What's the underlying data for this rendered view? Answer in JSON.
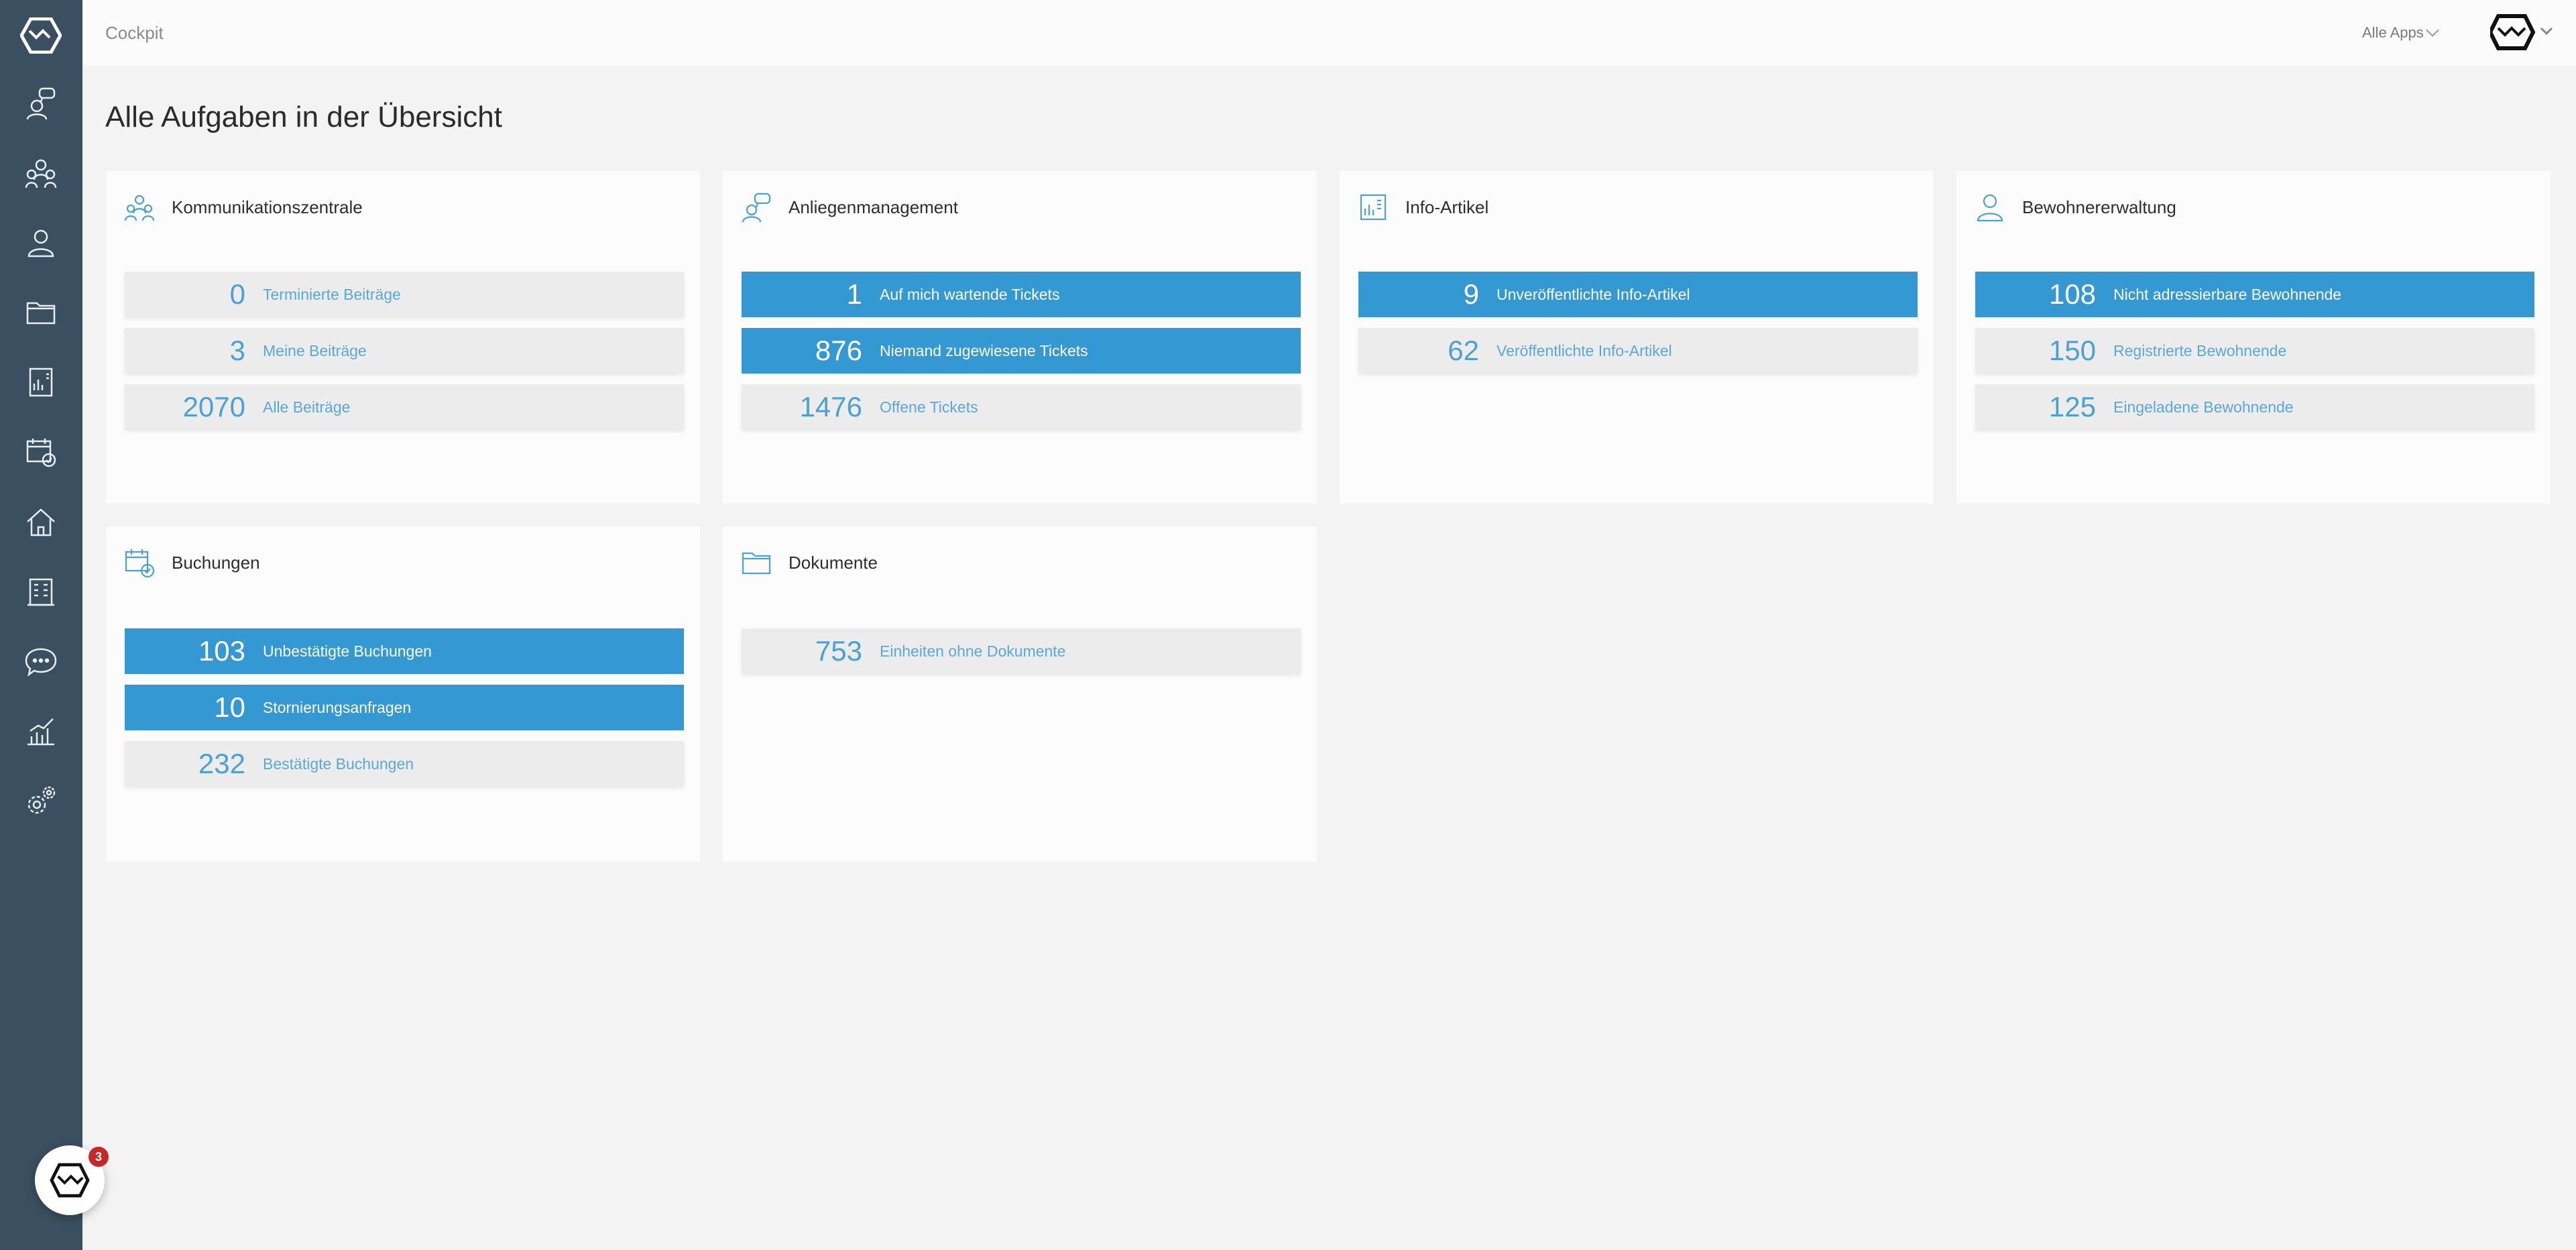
{
  "header": {
    "breadcrumb": "Cockpit",
    "apps_label": "Alle Apps"
  },
  "page": {
    "title": "Alle Aufgaben in der Übersicht"
  },
  "colors": {
    "sidebar": "#3a4f60",
    "accent": "#3498d3",
    "idle_row": "#ececec",
    "badge": "#c62828"
  },
  "sidebar": {
    "items": [
      {
        "icon": "support-agent-icon"
      },
      {
        "icon": "communication-center-icon"
      },
      {
        "icon": "person-icon"
      },
      {
        "icon": "folder-icon"
      },
      {
        "icon": "info-article-icon"
      },
      {
        "icon": "calendar-check-icon"
      },
      {
        "icon": "home-icon"
      },
      {
        "icon": "building-icon"
      },
      {
        "icon": "chat-bubble-icon"
      },
      {
        "icon": "analytics-icon"
      },
      {
        "icon": "settings-icon"
      }
    ]
  },
  "cards": {
    "kommunikation": {
      "title": "Kommunikationszentrale",
      "rows": [
        {
          "count": "0",
          "label": "Terminierte Beiträge"
        },
        {
          "count": "3",
          "label": "Meine Beiträge"
        },
        {
          "count": "2070",
          "label": "Alle Beiträge"
        }
      ]
    },
    "anliegen": {
      "title": "Anliegenmanagement",
      "rows": [
        {
          "count": "1",
          "label": "Auf mich wartende Tickets"
        },
        {
          "count": "876",
          "label": "Niemand zugewiesene Tickets"
        },
        {
          "count": "1476",
          "label": "Offene Tickets"
        }
      ]
    },
    "info": {
      "title": "Info-Artikel",
      "rows": [
        {
          "count": "9",
          "label": "Unveröffentlichte Info-Artikel"
        },
        {
          "count": "62",
          "label": "Veröffentlichte Info-Artikel"
        }
      ]
    },
    "bewohner": {
      "title": "Bewohnererwaltung",
      "rows": [
        {
          "count": "108",
          "label": "Nicht adressierbare Bewohnende"
        },
        {
          "count": "150",
          "label": "Registrierte Bewohnende"
        },
        {
          "count": "125",
          "label": "Eingeladene Bewohnende"
        }
      ]
    },
    "buchungen": {
      "title": "Buchungen",
      "rows": [
        {
          "count": "103",
          "label": "Unbestätigte Buchungen"
        },
        {
          "count": "10",
          "label": "Stornierungsanfragen"
        },
        {
          "count": "232",
          "label": "Bestätigte Buchungen"
        }
      ]
    },
    "dokumente": {
      "title": "Dokumente",
      "rows": [
        {
          "count": "753",
          "label": "Einheiten ohne Dokumente"
        }
      ]
    }
  },
  "chat": {
    "badge_count": "3"
  }
}
